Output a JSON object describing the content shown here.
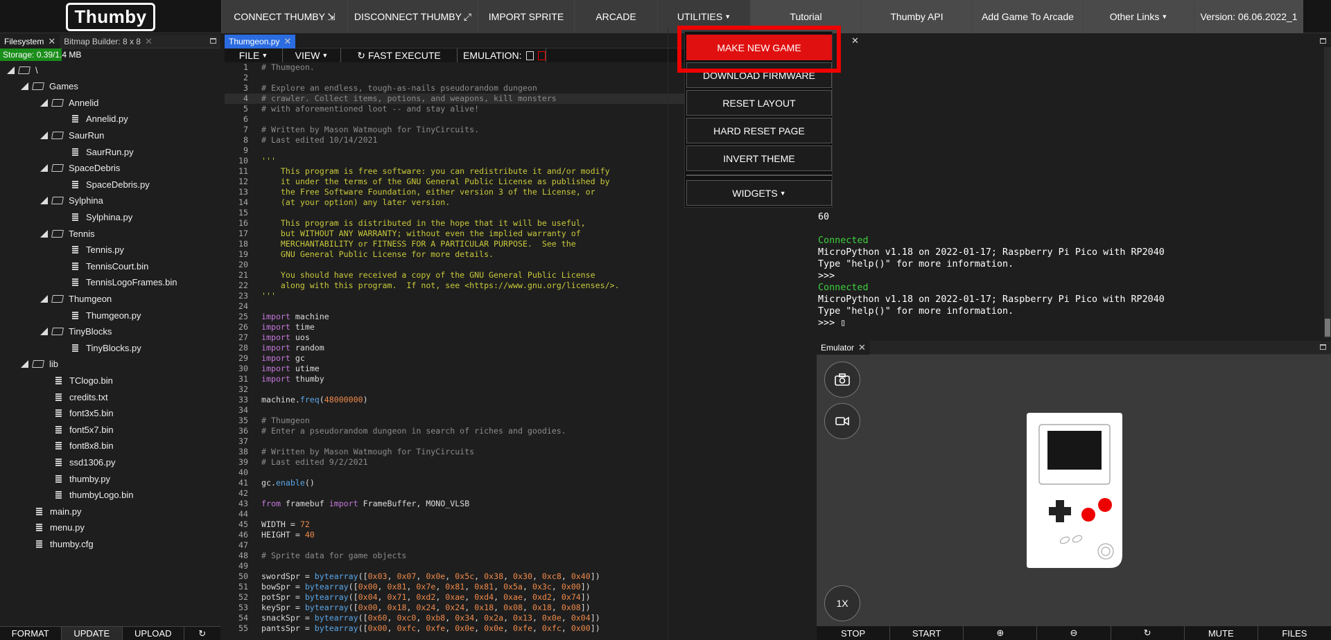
{
  "app": {
    "logo": "Thumby"
  },
  "topbar": {
    "connect": "CONNECT THUMBY",
    "disconnect": "DISCONNECT THUMBY",
    "import_sprite": "IMPORT SPRITE",
    "arcade": "ARCADE",
    "utilities": "UTILITIES",
    "tutorial": "Tutorial",
    "api": "Thumby API",
    "add_game": "Add Game To Arcade",
    "other_links": "Other Links",
    "version": "Version: 06.06.2022_1"
  },
  "filesystem": {
    "tab": "Filesystem",
    "bitmap_tab": "Bitmap Builder: 8 x 8",
    "storage": "Storage: 0.39/1.4 MB",
    "storage_fraction": 0.28,
    "tree": [
      {
        "label": "\\",
        "kind": "folder",
        "depth": 0
      },
      {
        "label": "Games",
        "kind": "folder",
        "depth": 1
      },
      {
        "label": "Annelid",
        "kind": "folder",
        "depth": 2
      },
      {
        "label": "Annelid.py",
        "kind": "file",
        "depth": 3
      },
      {
        "label": "SaurRun",
        "kind": "folder",
        "depth": 2
      },
      {
        "label": "SaurRun.py",
        "kind": "file",
        "depth": 3
      },
      {
        "label": "SpaceDebris",
        "kind": "folder",
        "depth": 2
      },
      {
        "label": "SpaceDebris.py",
        "kind": "file",
        "depth": 3
      },
      {
        "label": "Sylphina",
        "kind": "folder",
        "depth": 2
      },
      {
        "label": "Sylphina.py",
        "kind": "file",
        "depth": 3
      },
      {
        "label": "Tennis",
        "kind": "folder",
        "depth": 2
      },
      {
        "label": "Tennis.py",
        "kind": "file",
        "depth": 3
      },
      {
        "label": "TennisCourt.bin",
        "kind": "file",
        "depth": 3
      },
      {
        "label": "TennisLogoFrames.bin",
        "kind": "file",
        "depth": 3
      },
      {
        "label": "Thumgeon",
        "kind": "folder",
        "depth": 2
      },
      {
        "label": "Thumgeon.py",
        "kind": "file",
        "depth": 3
      },
      {
        "label": "TinyBlocks",
        "kind": "folder",
        "depth": 2
      },
      {
        "label": "TinyBlocks.py",
        "kind": "file",
        "depth": 3
      },
      {
        "label": "lib",
        "kind": "folder",
        "depth": 1
      },
      {
        "label": "TClogo.bin",
        "kind": "file",
        "depth": 2
      },
      {
        "label": "credits.txt",
        "kind": "file",
        "depth": 2
      },
      {
        "label": "font3x5.bin",
        "kind": "file",
        "depth": 2
      },
      {
        "label": "font5x7.bin",
        "kind": "file",
        "depth": 2
      },
      {
        "label": "font8x8.bin",
        "kind": "file",
        "depth": 2
      },
      {
        "label": "ssd1306.py",
        "kind": "file",
        "depth": 2
      },
      {
        "label": "thumby.py",
        "kind": "file",
        "depth": 2
      },
      {
        "label": "thumbyLogo.bin",
        "kind": "file",
        "depth": 2
      },
      {
        "label": "main.py",
        "kind": "file",
        "depth": 1
      },
      {
        "label": "menu.py",
        "kind": "file",
        "depth": 1
      },
      {
        "label": "thumby.cfg",
        "kind": "file",
        "depth": 1
      }
    ],
    "bottom": {
      "format": "FORMAT",
      "update": "UPDATE",
      "upload": "UPLOAD",
      "refresh": "↻"
    }
  },
  "editor": {
    "tab": "Thumgeon.py",
    "file_menu": "FILE",
    "view_menu": "VIEW",
    "fast_execute": "FAST EXECUTE",
    "emulation": "EMULATION:",
    "highlighted_line": 4,
    "lines": [
      [
        [
          "c-com",
          "# Thumgeon."
        ]
      ],
      [],
      [
        [
          "c-com",
          "# Explore an endless, tough-as-nails pseudorandom dungeon"
        ]
      ],
      [
        [
          "c-com",
          "# crawler. Collect items, potions, and weapons, kill monsters"
        ]
      ],
      [
        [
          "c-com",
          "# with aforementioned loot -- and stay alive!"
        ]
      ],
      [],
      [
        [
          "c-com",
          "# Written by Mason Watmough for TinyCircuits."
        ]
      ],
      [
        [
          "c-com",
          "# Last edited 10/14/2021"
        ]
      ],
      [],
      [
        [
          "c-doc",
          "'''"
        ]
      ],
      [
        [
          "c-doc",
          "    This program is free software: you can redistribute it and/or modify"
        ]
      ],
      [
        [
          "c-doc",
          "    it under the terms of the GNU General Public License as published by"
        ]
      ],
      [
        [
          "c-doc",
          "    the Free Software Foundation, either version 3 of the License, or"
        ]
      ],
      [
        [
          "c-doc",
          "    (at your option) any later version."
        ]
      ],
      [],
      [
        [
          "c-doc",
          "    This program is distributed in the hope that it will be useful,"
        ]
      ],
      [
        [
          "c-doc",
          "    but WITHOUT ANY WARRANTY; without even the implied warranty of"
        ]
      ],
      [
        [
          "c-doc",
          "    MERCHANTABILITY or FITNESS FOR A PARTICULAR PURPOSE.  See the"
        ]
      ],
      [
        [
          "c-doc",
          "    GNU General Public License for more details."
        ]
      ],
      [],
      [
        [
          "c-doc",
          "    You should have received a copy of the GNU General Public License"
        ]
      ],
      [
        [
          "c-doc",
          "    along with this program.  If not, see <https://www.gnu.org/licenses/>."
        ]
      ],
      [
        [
          "c-doc",
          "'''"
        ]
      ],
      [],
      [
        [
          "c-kw",
          "import"
        ],
        [
          "",
          "machine"
        ]
      ],
      [
        [
          "c-kw",
          "import"
        ],
        [
          "",
          "time"
        ]
      ],
      [
        [
          "c-kw",
          "import"
        ],
        [
          "",
          "uos"
        ]
      ],
      [
        [
          "c-kw",
          "import"
        ],
        [
          "",
          "random"
        ]
      ],
      [
        [
          "c-kw",
          "import"
        ],
        [
          "",
          "gc"
        ]
      ],
      [
        [
          "c-kw",
          "import"
        ],
        [
          "",
          "utime"
        ]
      ],
      [
        [
          "c-kw",
          "import"
        ],
        [
          "",
          "thumby"
        ]
      ],
      [],
      [
        [
          "",
          "machine."
        ],
        [
          "c-fn",
          "freq"
        ],
        [
          "",
          "("
        ],
        [
          "c-num",
          "48000000"
        ],
        [
          "",
          ")"
        ]
      ],
      [],
      [
        [
          "c-com",
          "# Thumgeon"
        ]
      ],
      [
        [
          "c-com",
          "# Enter a pseudorandom dungeon in search of riches and goodies."
        ]
      ],
      [],
      [
        [
          "c-com",
          "# Written by Mason Watmough for TinyCircuits"
        ]
      ],
      [
        [
          "c-com",
          "# Last edited 9/2/2021"
        ]
      ],
      [],
      [
        [
          "",
          "gc."
        ],
        [
          "c-fn",
          "enable"
        ],
        [
          "",
          "()"
        ]
      ],
      [],
      [
        [
          "c-kw",
          "from"
        ],
        [
          "",
          "framebuf"
        ],
        [
          "c-kw",
          "import"
        ],
        [
          "",
          "FrameBuffer, MONO_VLSB"
        ]
      ],
      [],
      [
        [
          "",
          "WIDTH = "
        ],
        [
          "c-num",
          "72"
        ]
      ],
      [
        [
          "",
          "HEIGHT = "
        ],
        [
          "c-num",
          "40"
        ]
      ],
      [],
      [
        [
          "c-com",
          "# Sprite data for game objects"
        ]
      ],
      [],
      [
        [
          "",
          "swordSpr = "
        ],
        [
          "c-fn",
          "bytearray"
        ],
        [
          "",
          "(["
        ],
        [
          "c-num",
          "0x03"
        ],
        [
          "",
          ", "
        ],
        [
          "c-num",
          "0x07"
        ],
        [
          "",
          ", "
        ],
        [
          "c-num",
          "0x0e"
        ],
        [
          "",
          ", "
        ],
        [
          "c-num",
          "0x5c"
        ],
        [
          "",
          ", "
        ],
        [
          "c-num",
          "0x38"
        ],
        [
          "",
          ", "
        ],
        [
          "c-num",
          "0x30"
        ],
        [
          "",
          ", "
        ],
        [
          "c-num",
          "0xc8"
        ],
        [
          "",
          ", "
        ],
        [
          "c-num",
          "0x40"
        ],
        [
          "",
          "])"
        ]
      ],
      [
        [
          "",
          "bowSpr = "
        ],
        [
          "c-fn",
          "bytearray"
        ],
        [
          "",
          "(["
        ],
        [
          "c-num",
          "0x00"
        ],
        [
          "",
          ", "
        ],
        [
          "c-num",
          "0x81"
        ],
        [
          "",
          ", "
        ],
        [
          "c-num",
          "0x7e"
        ],
        [
          "",
          ", "
        ],
        [
          "c-num",
          "0x81"
        ],
        [
          "",
          ", "
        ],
        [
          "c-num",
          "0x81"
        ],
        [
          "",
          ", "
        ],
        [
          "c-num",
          "0x5a"
        ],
        [
          "",
          ", "
        ],
        [
          "c-num",
          "0x3c"
        ],
        [
          "",
          ", "
        ],
        [
          "c-num",
          "0x00"
        ],
        [
          "",
          "])"
        ]
      ],
      [
        [
          "",
          "potSpr = "
        ],
        [
          "c-fn",
          "bytearray"
        ],
        [
          "",
          "(["
        ],
        [
          "c-num",
          "0x04"
        ],
        [
          "",
          ", "
        ],
        [
          "c-num",
          "0x71"
        ],
        [
          "",
          ", "
        ],
        [
          "c-num",
          "0xd2"
        ],
        [
          "",
          ", "
        ],
        [
          "c-num",
          "0xae"
        ],
        [
          "",
          ", "
        ],
        [
          "c-num",
          "0xd4"
        ],
        [
          "",
          ", "
        ],
        [
          "c-num",
          "0xae"
        ],
        [
          "",
          ", "
        ],
        [
          "c-num",
          "0xd2"
        ],
        [
          "",
          ", "
        ],
        [
          "c-num",
          "0x74"
        ],
        [
          "",
          "])"
        ]
      ],
      [
        [
          "",
          "keySpr = "
        ],
        [
          "c-fn",
          "bytearray"
        ],
        [
          "",
          "(["
        ],
        [
          "c-num",
          "0x00"
        ],
        [
          "",
          ", "
        ],
        [
          "c-num",
          "0x18"
        ],
        [
          "",
          ", "
        ],
        [
          "c-num",
          "0x24"
        ],
        [
          "",
          ", "
        ],
        [
          "c-num",
          "0x24"
        ],
        [
          "",
          ", "
        ],
        [
          "c-num",
          "0x18"
        ],
        [
          "",
          ", "
        ],
        [
          "c-num",
          "0x08"
        ],
        [
          "",
          ", "
        ],
        [
          "c-num",
          "0x18"
        ],
        [
          "",
          ", "
        ],
        [
          "c-num",
          "0x08"
        ],
        [
          "",
          "])"
        ]
      ],
      [
        [
          "",
          "snackSpr = "
        ],
        [
          "c-fn",
          "bytearray"
        ],
        [
          "",
          "(["
        ],
        [
          "c-num",
          "0x60"
        ],
        [
          "",
          ", "
        ],
        [
          "c-num",
          "0xc0"
        ],
        [
          "",
          ", "
        ],
        [
          "c-num",
          "0xb8"
        ],
        [
          "",
          ", "
        ],
        [
          "c-num",
          "0x34"
        ],
        [
          "",
          ", "
        ],
        [
          "c-num",
          "0x2a"
        ],
        [
          "",
          ", "
        ],
        [
          "c-num",
          "0x13"
        ],
        [
          "",
          ", "
        ],
        [
          "c-num",
          "0x0e"
        ],
        [
          "",
          ", "
        ],
        [
          "c-num",
          "0x04"
        ],
        [
          "",
          "])"
        ]
      ],
      [
        [
          "",
          "pantsSpr = "
        ],
        [
          "c-fn",
          "bytearray"
        ],
        [
          "",
          "(["
        ],
        [
          "c-num",
          "0x00"
        ],
        [
          "",
          ", "
        ],
        [
          "c-num",
          "0xfc"
        ],
        [
          "",
          ", "
        ],
        [
          "c-num",
          "0xfe"
        ],
        [
          "",
          ", "
        ],
        [
          "c-num",
          "0x0e"
        ],
        [
          "",
          ", "
        ],
        [
          "c-num",
          "0x0e"
        ],
        [
          "",
          ", "
        ],
        [
          "c-num",
          "0xfe"
        ],
        [
          "",
          ", "
        ],
        [
          "c-num",
          "0xfc"
        ],
        [
          "",
          ", "
        ],
        [
          "c-num",
          "0x00"
        ],
        [
          "",
          "])"
        ]
      ]
    ]
  },
  "utilities_menu": {
    "make_new_game": "MAKE NEW GAME",
    "download_firmware": "DOWNLOAD FIRMWARE",
    "reset_layout": "RESET LAYOUT",
    "hard_reset": "HARD RESET PAGE",
    "invert_theme": "INVERT THEME",
    "widgets": "WIDGETS"
  },
  "shell": {
    "lines": [
      {
        "text": "60",
        "cls": ""
      },
      {
        "text": "",
        "cls": ""
      },
      {
        "text": "Connected",
        "cls": "sh-green"
      },
      {
        "text": "MicroPython v1.18 on 2022-01-17; Raspberry Pi Pico with RP2040",
        "cls": ""
      },
      {
        "text": "Type \"help()\" for more information.",
        "cls": ""
      },
      {
        "text": ">>>",
        "cls": ""
      },
      {
        "text": "Connected",
        "cls": "sh-green"
      },
      {
        "text": "MicroPython v1.18 on 2022-01-17; Raspberry Pi Pico with RP2040",
        "cls": ""
      },
      {
        "text": "Type \"help()\" for more information.",
        "cls": ""
      },
      {
        "text": ">>> ▯",
        "cls": ""
      }
    ]
  },
  "emulator": {
    "tab": "Emulator",
    "scale": "1X",
    "bottom": {
      "stop": "STOP",
      "start": "START",
      "zoom_in": "⊕",
      "zoom_out": "⊖",
      "rotate": "↻",
      "mute": "MUTE",
      "files": "FILES"
    }
  },
  "colors": {
    "accent_red": "#e01010",
    "storage_green": "#1a8d1a"
  }
}
